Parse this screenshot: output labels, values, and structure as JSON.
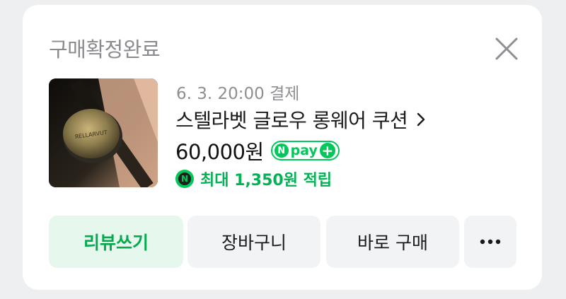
{
  "order": {
    "status": "구매확정완료",
    "meta": "6. 3. 20:00 결제",
    "product_title": "스텔라벳 글로우 롱웨어 쿠션",
    "price": "60,000원",
    "npay_label": "pay",
    "npay_brand": "N",
    "reward_text": "최대 1,350원 적립",
    "brand_mark": "ЯELLARVUT"
  },
  "actions": {
    "review": "리뷰쓰기",
    "cart": "장바구니",
    "buy": "바로 구매",
    "more": "···"
  },
  "colors": {
    "accent": "#03c75a",
    "review_bg": "#e6f8ee",
    "button_bg": "#f2f3f5",
    "page_bg": "#eeeff1"
  },
  "icons": [
    "close-icon",
    "chevron-right-icon",
    "naver-pay-plus-icon",
    "naver-point-icon",
    "more-icon"
  ]
}
